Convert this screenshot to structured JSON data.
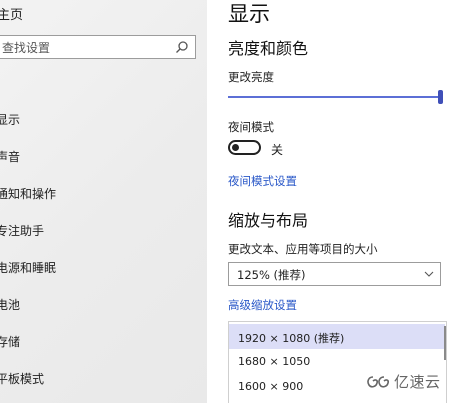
{
  "sidebar": {
    "home_label": "主页",
    "search_placeholder": "查找设置",
    "items": [
      {
        "label": "显示"
      },
      {
        "label": "声音"
      },
      {
        "label": "通知和操作"
      },
      {
        "label": "专注助手"
      },
      {
        "label": "电源和睡眠"
      },
      {
        "label": "电池"
      },
      {
        "label": "存储"
      },
      {
        "label": "平板模式"
      }
    ]
  },
  "main": {
    "page_title": "显示",
    "brightness": {
      "section_title": "亮度和颜色",
      "slider_label": "更改亮度",
      "slider_value_pct": 100,
      "night_light_label": "夜间模式",
      "night_light_state": "关",
      "night_light_settings_link": "夜间模式设置"
    },
    "scale": {
      "section_title": "缩放与布局",
      "scale_label": "更改文本、应用等项目的大小",
      "scale_value": "125% (推荐)",
      "advanced_link": "高级缩放设置"
    },
    "resolution_dropdown": {
      "options": [
        {
          "label": "1920 × 1080 (推荐)",
          "selected": true
        },
        {
          "label": "1680 × 1050",
          "selected": false
        },
        {
          "label": "1600 × 900",
          "selected": false
        }
      ]
    }
  },
  "watermark": {
    "text": "亿速云"
  },
  "colors": {
    "accent": "#3f4fb8",
    "link": "#2a58c8",
    "selected_option": "#dcdef7"
  }
}
